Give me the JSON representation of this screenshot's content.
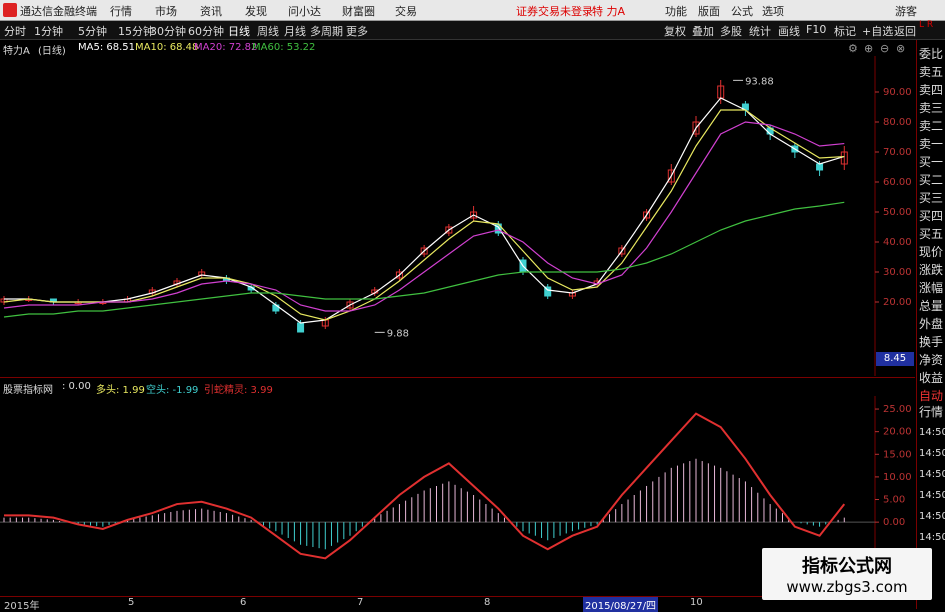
{
  "app": {
    "title": "通达信金融终端",
    "menus": [
      "行情",
      "市场",
      "资讯",
      "发现",
      "问小达",
      "财富圈",
      "交易"
    ],
    "notice": "证券交易未登录",
    "stock_name": "特 力A",
    "right_menus": [
      "功能",
      "版面",
      "公式",
      "选项"
    ],
    "guest": "游客"
  },
  "toolbar": {
    "periods": [
      "分时",
      "1分钟",
      "5分钟",
      "15分钟",
      "30分钟",
      "60分钟",
      "日线",
      "周线",
      "月线",
      "多周期",
      "更多"
    ],
    "selected": "日线",
    "right_buttons": [
      "复权",
      "叠加",
      "多股",
      "统计",
      "画线",
      "F10",
      "标记",
      "+自选",
      "返回"
    ]
  },
  "ma_legend": {
    "stock": "特力A",
    "period": "(日线)",
    "items": [
      {
        "label": "MA5: 68.51",
        "color": "#ffffff"
      },
      {
        "label": "MA10: 68.48",
        "color": "#e8e860"
      },
      {
        "label": "MA20: 72.82",
        "color": "#d040d0"
      },
      {
        "label": "MA60: 53.22",
        "color": "#40c040"
      }
    ]
  },
  "indicator_legend": {
    "name": "股票指标网",
    "value": ": 0.00",
    "items": [
      {
        "label": "多头: 1.99",
        "color": "#e8e860"
      },
      {
        "label": "空头: -1.99",
        "color": "#40d0d0"
      },
      {
        "label": "引蛇精灵: 3.99",
        "color": "#e03030"
      }
    ]
  },
  "right_panel": {
    "order_items": [
      "委比",
      "卖五",
      "卖四",
      "卖三",
      "卖二",
      "卖一",
      "买一",
      "买二",
      "买三",
      "买四",
      "买五",
      "现价",
      "涨跌",
      "涨幅",
      "总量",
      "外盘",
      "换手",
      "净资",
      "收益"
    ],
    "tab_labels": [
      "自动",
      "行情"
    ],
    "time_labels": [
      "14:50",
      "14:50",
      "14:50",
      "14:50",
      "14:50",
      "14:50"
    ],
    "price_box": "8.45",
    "top_label": "L R"
  },
  "chart_data": [
    {
      "type": "candlestick",
      "ylim": [
        0,
        100
      ],
      "yticks": [
        20.0,
        30.0,
        40.0,
        50.0,
        60.0,
        70.0,
        80.0,
        90.0
      ],
      "annotations": [
        {
          "label": "93.88",
          "x": 59,
          "y": 93.88
        },
        {
          "label": "9.88",
          "x": 30,
          "y": 9.88
        }
      ],
      "x": [
        0,
        2,
        4,
        6,
        8,
        10,
        12,
        14,
        16,
        18,
        20,
        22,
        24,
        26,
        28,
        30,
        32,
        34,
        36,
        38,
        40,
        42,
        44,
        46,
        48,
        50,
        52,
        54,
        56,
        58,
        60,
        62,
        64,
        66,
        68
      ],
      "close": [
        21,
        21,
        20,
        20,
        20,
        21,
        24,
        27,
        30,
        27,
        24,
        17,
        10,
        14,
        20,
        24,
        30,
        38,
        45,
        50,
        43,
        30,
        22,
        23,
        27,
        38,
        50,
        64,
        80,
        92,
        84,
        76,
        70,
        64,
        70
      ],
      "open": [
        20,
        21,
        21,
        20,
        20,
        20,
        23,
        26,
        29,
        28,
        25,
        19,
        13,
        12,
        18,
        23,
        28,
        36,
        43,
        48,
        46,
        34,
        25,
        22,
        26,
        36,
        48,
        60,
        76,
        88,
        86,
        78,
        72,
        66,
        66
      ],
      "high": [
        22,
        22,
        21,
        21,
        21,
        22,
        25,
        28,
        31,
        29,
        26,
        20,
        14,
        15,
        21,
        25,
        31,
        39,
        46,
        52,
        47,
        35,
        26,
        24,
        28,
        39,
        51,
        66,
        82,
        94,
        87,
        79,
        73,
        67,
        72
      ],
      "low": [
        19,
        20,
        19,
        19,
        19,
        20,
        22,
        25,
        28,
        26,
        23,
        16,
        9.88,
        11,
        17,
        22,
        27,
        35,
        42,
        47,
        42,
        29,
        21,
        21,
        25,
        35,
        47,
        59,
        75,
        86,
        82,
        74,
        68,
        62,
        64
      ],
      "series": [
        {
          "name": "MA5",
          "values": [
            21,
            21,
            20,
            20,
            20,
            21,
            23,
            26,
            29,
            28,
            25,
            19,
            13,
            14,
            19,
            23,
            29,
            37,
            44,
            49,
            45,
            32,
            24,
            23,
            26,
            37,
            49,
            62,
            78,
            88,
            84,
            76,
            71,
            66,
            68.51
          ]
        },
        {
          "name": "MA10",
          "values": [
            20,
            21,
            20,
            20,
            20,
            20,
            22,
            25,
            28,
            28,
            26,
            22,
            16,
            14,
            17,
            21,
            27,
            34,
            41,
            47,
            46,
            37,
            28,
            24,
            25,
            33,
            45,
            57,
            72,
            84,
            84,
            78,
            73,
            68,
            68.48
          ]
        },
        {
          "name": "MA20",
          "values": [
            18,
            19,
            19,
            19,
            20,
            20,
            21,
            23,
            26,
            27,
            26,
            24,
            19,
            17,
            17,
            19,
            24,
            30,
            36,
            42,
            44,
            40,
            33,
            28,
            26,
            29,
            38,
            50,
            63,
            76,
            80,
            79,
            76,
            72,
            72.82
          ]
        },
        {
          "name": "MA60",
          "values": [
            15,
            16,
            16,
            17,
            17,
            18,
            19,
            20,
            21,
            22,
            23,
            23,
            22,
            21,
            21,
            21,
            22,
            23,
            25,
            27,
            29,
            30,
            30,
            30,
            30,
            31,
            33,
            36,
            40,
            44,
            47,
            49,
            51,
            52,
            53.22
          ]
        }
      ]
    },
    {
      "type": "bar",
      "ylim": [
        -15,
        27
      ],
      "yticks": [
        0.0,
        5.0,
        10.0,
        15.0,
        20.0,
        25.0
      ],
      "x": [
        0,
        2,
        4,
        6,
        8,
        10,
        12,
        14,
        16,
        18,
        20,
        22,
        24,
        26,
        28,
        30,
        32,
        34,
        36,
        38,
        40,
        42,
        44,
        46,
        48,
        50,
        52,
        54,
        56,
        58,
        60,
        62,
        64,
        66,
        68
      ],
      "values": [
        1,
        1,
        0.5,
        -0.5,
        -1,
        0.5,
        1.5,
        2.5,
        3,
        2,
        0.5,
        -2,
        -5,
        -6,
        -3,
        1,
        4,
        7,
        9,
        6,
        2,
        -2,
        -4,
        -2,
        -0.5,
        4,
        8,
        12,
        14,
        12,
        9,
        4,
        0,
        -1,
        1
      ],
      "series": [
        {
          "name": "引蛇精灵",
          "values": [
            1.5,
            1.5,
            1,
            -0.5,
            -1.5,
            0.5,
            2,
            4,
            4.5,
            3,
            1,
            -3,
            -7,
            -8,
            -4,
            1,
            6,
            10,
            13,
            8,
            3,
            -3,
            -6,
            -3,
            -1,
            6,
            12,
            18,
            24,
            21,
            14,
            6,
            -1,
            -3,
            3.99
          ]
        }
      ]
    }
  ],
  "x_axis": [
    "2015年",
    "5",
    "6",
    "7",
    "8",
    "2015/08/27/四",
    "10"
  ],
  "watermark": {
    "line1": "指标公式网",
    "line2": "www.zbgs3.com"
  }
}
